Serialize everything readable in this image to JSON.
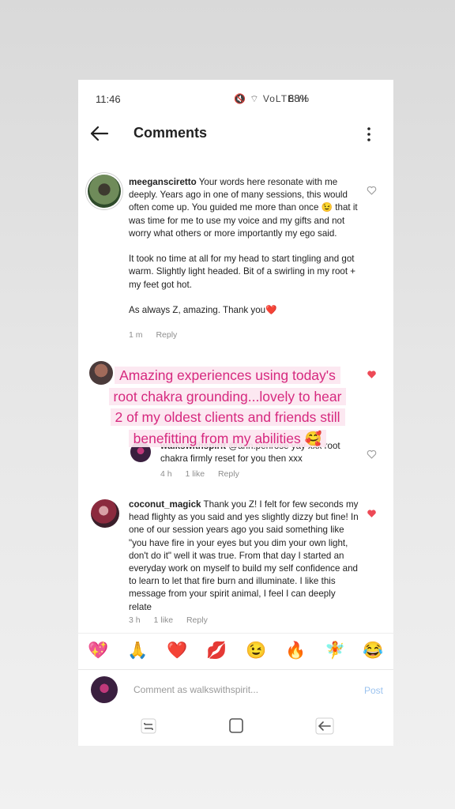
{
  "status_bar": {
    "time": "11:46",
    "icons_text": "🔇 ⌔ VoLTE ıll",
    "battery": "88%"
  },
  "header": {
    "title": "Comments",
    "back_icon": "arrow-left-icon",
    "more_icon": "more-vertical-icon"
  },
  "comments": [
    {
      "username": "meegansciretto",
      "text": " Your words here resonate with me deeply.  Years ago in one of many sessions, this would often come up.  You guided me more than once 😉 that it was time for me to use my voice and my gifts and not worry what others or more importantly my ego said.\n\nIt took no time at all for my head to start tingling and got warm. Slightly light headed. Bit of a swirling in my root + my feet got hot.\n\nAs always Z, amazing.  Thank you❤️",
      "time": "1 m",
      "reply": "Reply"
    },
    {
      "username": "walkswithspirit",
      "mention": "@ann.penrose",
      "text": " yay xxx root chakra firmly reset for you then xxx",
      "time": "4 h",
      "likes": "1 like",
      "reply": "Reply"
    },
    {
      "username": "coconut_magick",
      "text": " Thank you Z! I felt for few seconds my head flighty as you said and yes slightly dizzy but fine! In one of our session years ago you said something like \"you have fire in your eyes but you dim your own light, don't do it\" well it was true. From that day I started an everyday work on myself to build my self confidence and to learn to let that fire burn and illuminate. I like this message from your spirit animal, I feel I can deeply relate",
      "time": "3 h",
      "likes": "1 like",
      "reply": "Reply"
    }
  ],
  "overlay_lines": [
    "Amazing experiences using today's",
    "root chakra grounding...lovely to hear",
    "2 of my oldest clients and friends still",
    "benefitting from my abilities 🥰"
  ],
  "reactions": [
    "💖",
    "🙏",
    "❤️",
    "💋",
    "😉",
    "🔥",
    "🧚",
    "😂"
  ],
  "composer": {
    "placeholder": "Comment as walkswithspirit...",
    "post": "Post"
  },
  "colors": {
    "liked": "#ed4956",
    "overlay_text": "#d6287e",
    "post_disabled": "#9cc3ef"
  }
}
